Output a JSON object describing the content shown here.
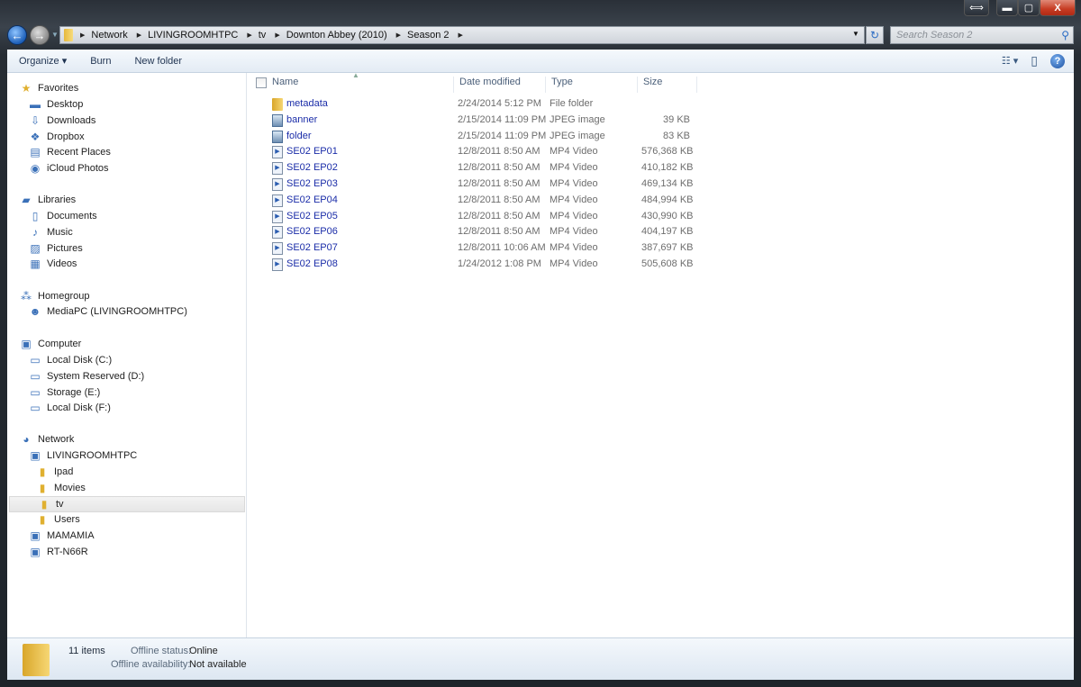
{
  "window": {
    "caption_buttons": {
      "swap": "⟺",
      "minimize": "▬",
      "maximize": "▢",
      "close": "X"
    }
  },
  "address": {
    "crumbs": [
      "Network",
      "LIVINGROOMHTPC",
      "tv",
      "Downton Abbey (2010)",
      "Season 2"
    ],
    "search_placeholder": "Search Season 2"
  },
  "toolbar": {
    "organize": "Organize ▾",
    "burn": "Burn",
    "new_folder": "New folder",
    "views": "☷ ▾",
    "preview": "▯",
    "help": "?"
  },
  "nav": {
    "favorites": {
      "label": "Favorites",
      "items": [
        "Desktop",
        "Downloads",
        "Dropbox",
        "Recent Places",
        "iCloud Photos"
      ]
    },
    "libraries": {
      "label": "Libraries",
      "items": [
        "Documents",
        "Music",
        "Pictures",
        "Videos"
      ]
    },
    "homegroup": {
      "label": "Homegroup",
      "items": [
        "MediaPC (LIVINGROOMHTPC)"
      ]
    },
    "computer": {
      "label": "Computer",
      "items": [
        "Local Disk (C:)",
        "System Reserved (D:)",
        "Storage (E:)",
        "Local Disk (F:)"
      ]
    },
    "network": {
      "label": "Network",
      "host": "LIVINGROOMHTPC",
      "shares": [
        "Ipad",
        "Movies",
        "tv",
        "Users"
      ],
      "others": [
        "MAMAMIA",
        "RT-N66R"
      ],
      "selected": "tv"
    }
  },
  "columns": {
    "name": "Name",
    "date": "Date modified",
    "type": "Type",
    "size": "Size"
  },
  "files": [
    {
      "name": "metadata",
      "date": "2/24/2014 5:12 PM",
      "type": "File folder",
      "size": "",
      "icon": "folder"
    },
    {
      "name": "banner",
      "date": "2/15/2014 11:09 PM",
      "type": "JPEG image",
      "size": "39 KB",
      "icon": "image"
    },
    {
      "name": "folder",
      "date": "2/15/2014 11:09 PM",
      "type": "JPEG image",
      "size": "83 KB",
      "icon": "image"
    },
    {
      "name": "SE02 EP01",
      "date": "12/8/2011 8:50 AM",
      "type": "MP4 Video",
      "size": "576,368 KB",
      "icon": "video"
    },
    {
      "name": "SE02 EP02",
      "date": "12/8/2011 8:50 AM",
      "type": "MP4 Video",
      "size": "410,182 KB",
      "icon": "video"
    },
    {
      "name": "SE02 EP03",
      "date": "12/8/2011 8:50 AM",
      "type": "MP4 Video",
      "size": "469,134 KB",
      "icon": "video"
    },
    {
      "name": "SE02 EP04",
      "date": "12/8/2011 8:50 AM",
      "type": "MP4 Video",
      "size": "484,994 KB",
      "icon": "video"
    },
    {
      "name": "SE02 EP05",
      "date": "12/8/2011 8:50 AM",
      "type": "MP4 Video",
      "size": "430,990 KB",
      "icon": "video"
    },
    {
      "name": "SE02 EP06",
      "date": "12/8/2011 8:50 AM",
      "type": "MP4 Video",
      "size": "404,197 KB",
      "icon": "video"
    },
    {
      "name": "SE02 EP07",
      "date": "12/8/2011 10:06 AM",
      "type": "MP4 Video",
      "size": "387,697 KB",
      "icon": "video"
    },
    {
      "name": "SE02 EP08",
      "date": "1/24/2012 1:08 PM",
      "type": "MP4 Video",
      "size": "505,608 KB",
      "icon": "video"
    }
  ],
  "status": {
    "count": "11 items",
    "offline_status_label": "Offline status:",
    "offline_status": "Online",
    "offline_avail_label": "Offline availability:",
    "offline_avail": "Not available"
  }
}
